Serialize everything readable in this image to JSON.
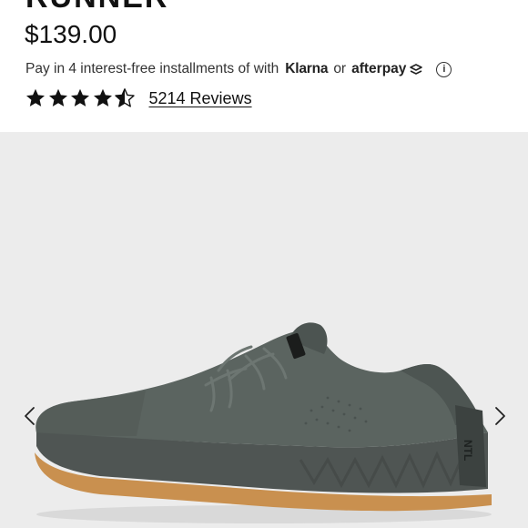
{
  "product": {
    "name_partial": "RUNNER",
    "price": "$139.00"
  },
  "payment": {
    "text": "Pay in 4 interest-free installments of with",
    "klarna": "Klarna",
    "or": "or",
    "afterpay": "afterpay",
    "info_icon": "info-icon"
  },
  "rating": {
    "stars": 4.5,
    "out_of": 5,
    "reviews_label": "5214 Reviews"
  },
  "gallery": {
    "prev_icon": "chevron-left-icon",
    "next_icon": "chevron-right-icon",
    "shoe_brand_mark": "NTL"
  },
  "colors": {
    "background": "#ffffff",
    "gallery_bg": "#ececec",
    "text": "#111111",
    "shoe_upper": "#5b6460",
    "sole": "#4f5553",
    "gum_outsole": "#c9904f"
  }
}
